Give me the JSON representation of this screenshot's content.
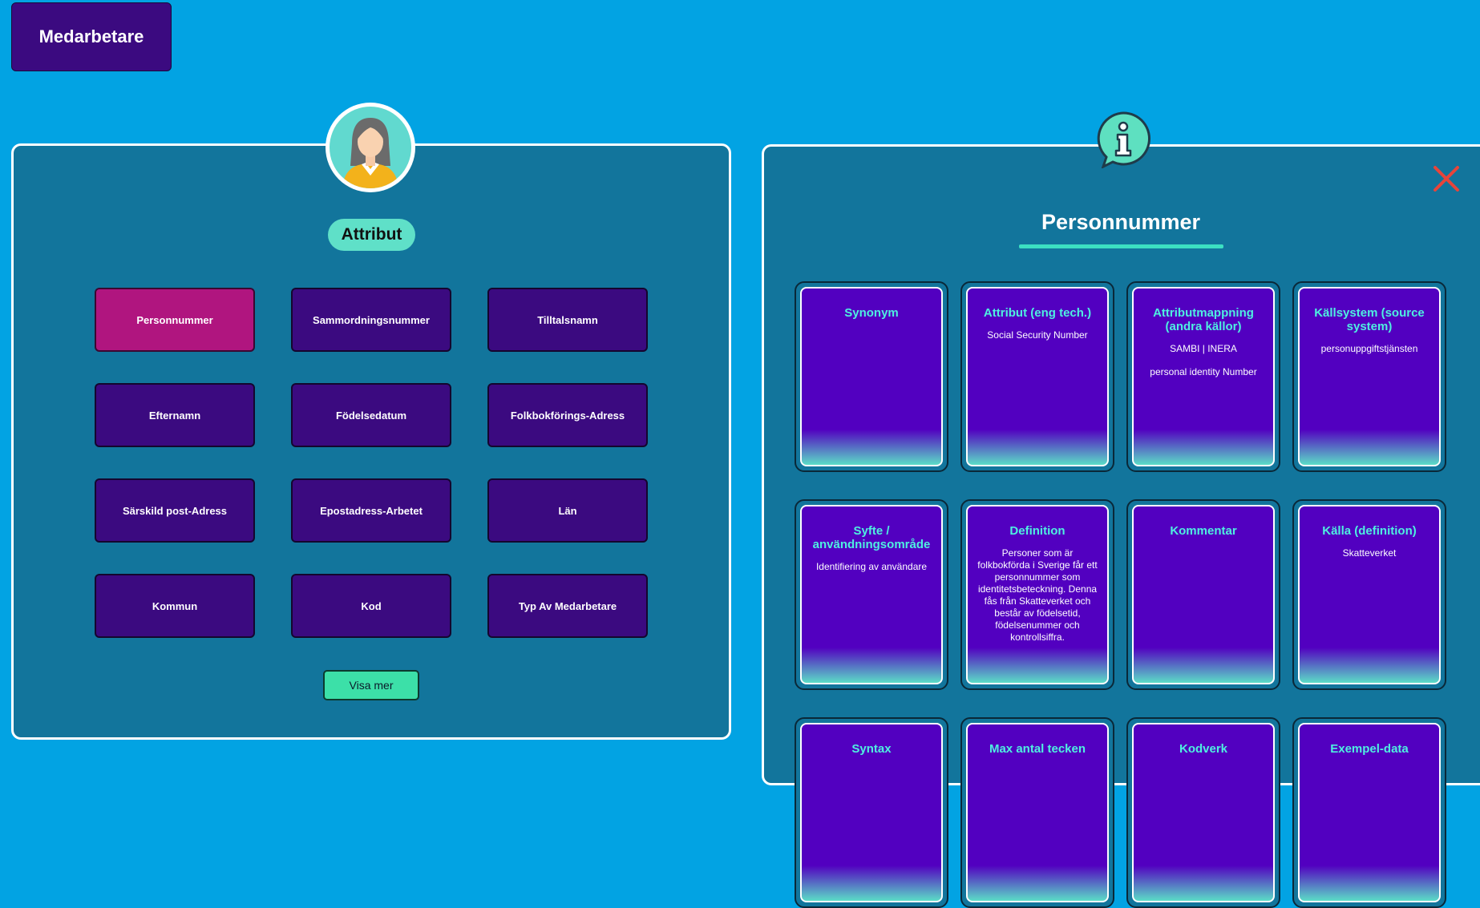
{
  "header": {
    "title": "Medarbetare"
  },
  "attributes_panel": {
    "heading": "Attribut",
    "buttons": [
      "Personnummer",
      "Sammordningsnummer",
      "Tilltalsnamn",
      "Efternamn",
      "Födelsedatum",
      "Folkbokförings-Adress",
      "Särskild post-Adress",
      "Epostadress-Arbetet",
      "Län",
      "Kommun",
      "Kod",
      "Typ Av Medarbetare"
    ],
    "active": "Personnummer",
    "show_more": "Visa mer"
  },
  "detail_panel": {
    "title": "Personnummer",
    "cards": [
      {
        "title": "Synonym",
        "values": []
      },
      {
        "title": "Attribut (eng tech.)",
        "values": [
          "Social Security Number"
        ]
      },
      {
        "title": "Attributmappning (andra källor)",
        "values": [
          "SAMBI | INERA",
          "personal identity Number"
        ]
      },
      {
        "title": "Källsystem (source system)",
        "values": [
          "personuppgiftstjänsten"
        ]
      },
      {
        "title": "Syfte / användningsområde",
        "values": [
          "Identifiering av användare"
        ]
      },
      {
        "title": "Definition",
        "values": [
          "Personer som är folkbokförda i Sverige får ett personnummer som identitetsbeteckning. Denna fås från Skatteverket och består av födelsetid, födelsenummer och kontrollsiffra."
        ]
      },
      {
        "title": "Kommentar",
        "values": []
      },
      {
        "title": "Källa (definition)",
        "values": [
          "Skatteverket"
        ]
      },
      {
        "title": "Syntax",
        "values": []
      },
      {
        "title": "Max antal tecken",
        "values": []
      },
      {
        "title": "Kodverk",
        "values": []
      },
      {
        "title": "Exempel-data",
        "values": []
      }
    ]
  },
  "icons": {
    "avatar": "woman-avatar-icon",
    "info": "info-speech-bubble-icon",
    "close": "close-icon"
  },
  "colors": {
    "background": "#02a3e3",
    "panel": "#12759c",
    "button": "#3b0a80",
    "active_button": "#b0157f",
    "card": "#5200c0",
    "accent": "#3ce0c2",
    "close": "#e8443a"
  }
}
